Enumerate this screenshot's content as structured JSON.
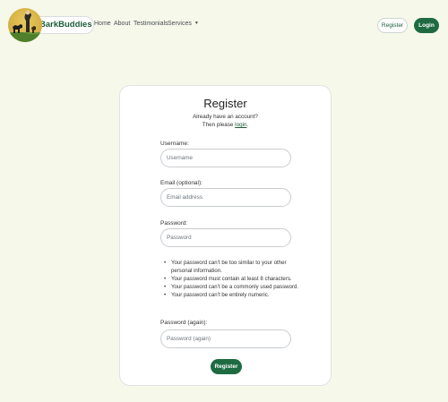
{
  "navbar": {
    "brand": "BarkBuddies",
    "links": [
      {
        "label": "Home"
      },
      {
        "label": "About"
      },
      {
        "label": "Testimonials"
      },
      {
        "label": "Services",
        "dropdown": true
      }
    ],
    "register_label": "Register",
    "login_label": "Login"
  },
  "form": {
    "title": "Register",
    "subtitle_line1": "Already have an account?",
    "subtitle_prefix": "Then please ",
    "login_link": "login",
    "subtitle_suffix": ".",
    "fields": [
      {
        "label": "Username:",
        "placeholder": "Username"
      },
      {
        "label": "Email (optional):",
        "placeholder": "Email address"
      },
      {
        "label": "Password:",
        "placeholder": "Password"
      },
      {
        "label": "Password (again):",
        "placeholder": "Password (again)"
      }
    ],
    "password_help": [
      "Your password can’t be too similar to your other personal information.",
      "Your password must contain at least 8 characters.",
      "Your password can’t be a commonly used password.",
      "Your password can’t be entirely numeric."
    ],
    "submit_label": "Register"
  },
  "colors": {
    "background": "#f6f8e9",
    "accent": "#1e6b41",
    "brand_text": "#1e5b3a"
  }
}
